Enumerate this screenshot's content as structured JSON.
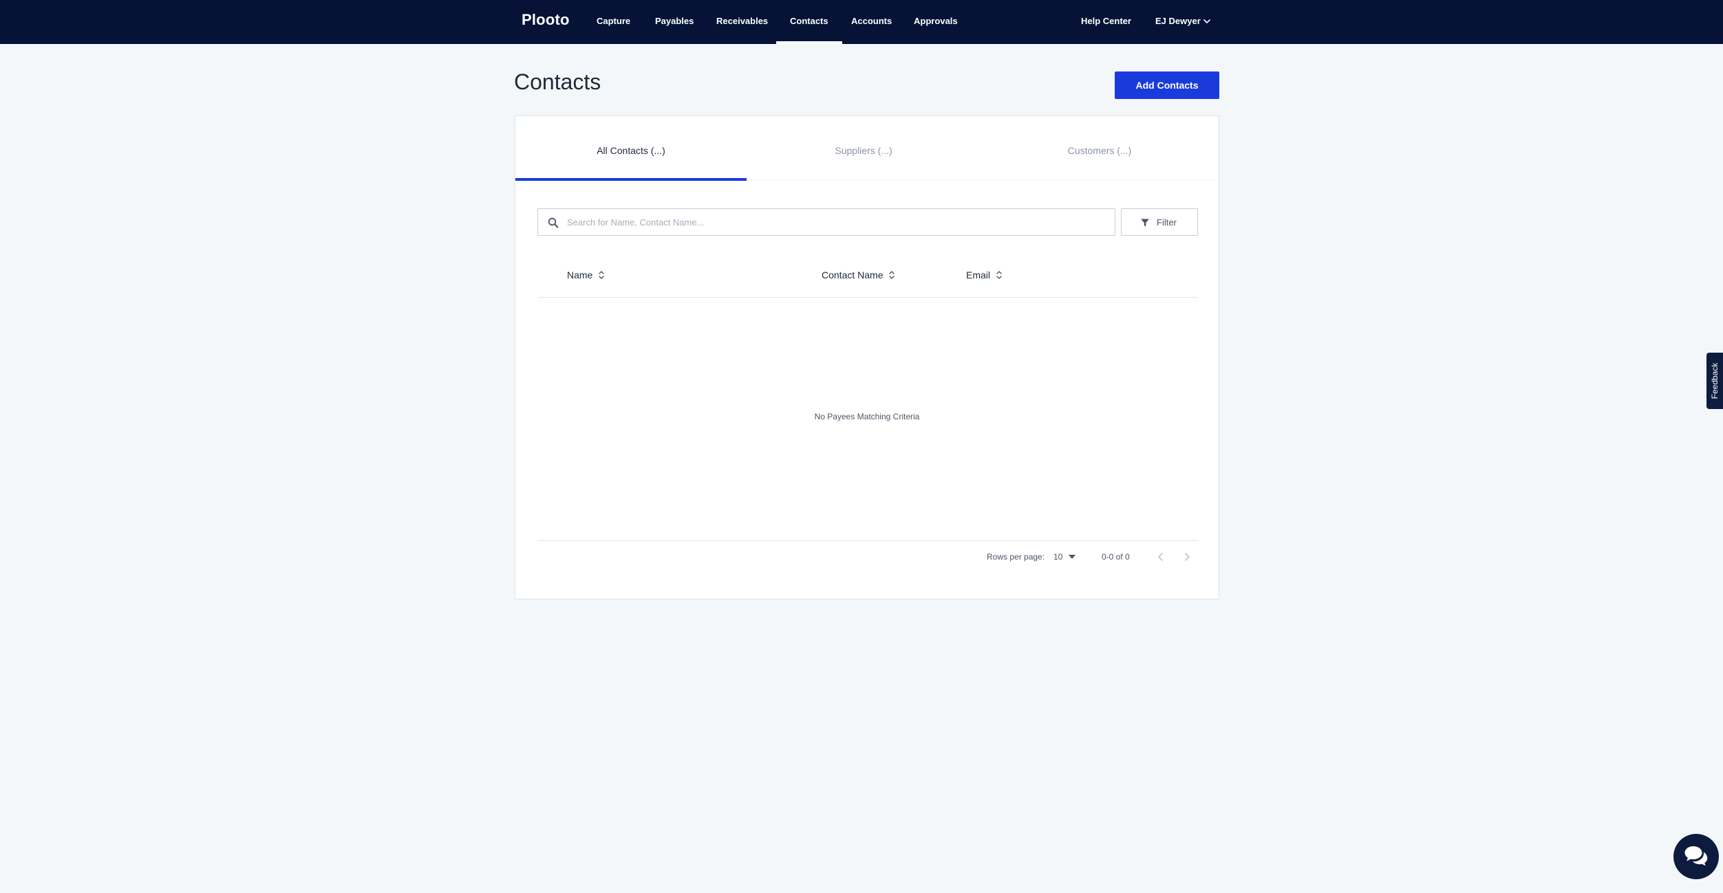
{
  "nav": {
    "brand": "Plooto",
    "items": [
      {
        "label": "Capture"
      },
      {
        "label": "Payables"
      },
      {
        "label": "Receivables"
      },
      {
        "label": "Contacts",
        "active": true
      },
      {
        "label": "Accounts"
      },
      {
        "label": "Approvals"
      }
    ],
    "help_center": "Help Center",
    "user_name": "EJ Dewyer"
  },
  "page": {
    "title": "Contacts",
    "add_button": "Add Contacts"
  },
  "tabs": [
    {
      "label": "All Contacts (...)",
      "active": true
    },
    {
      "label": "Suppliers (...)",
      "active": false
    },
    {
      "label": "Customers (...)",
      "active": false
    }
  ],
  "search": {
    "placeholder": "Search for Name, Contact Name...",
    "value": ""
  },
  "filter": {
    "label": "Filter"
  },
  "table": {
    "columns": [
      "Name",
      "Contact Name",
      "Email"
    ],
    "rows": [],
    "empty_message": "No Payees Matching Criteria"
  },
  "pagination": {
    "rows_per_page_label": "Rows per page:",
    "rows_per_page": "10",
    "range": "0-0 of 0"
  },
  "widgets": {
    "feedback_label": "Feedback"
  },
  "colors": {
    "nav_bg": "#061337",
    "accent": "#1a3bdc",
    "page_bg": "#f4f7fa"
  }
}
